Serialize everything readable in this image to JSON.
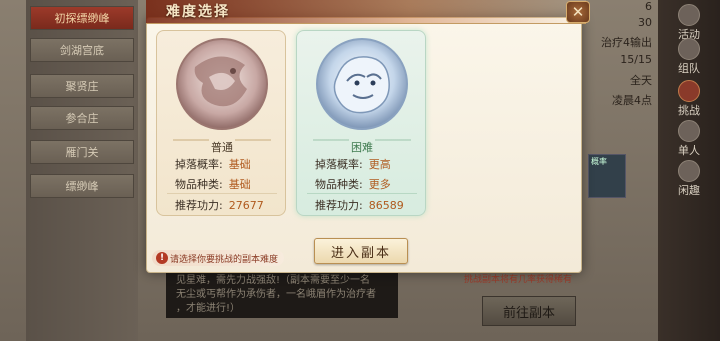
{
  "background": {
    "left_menu": [
      "初探缥缈峰",
      "剑湖宫底",
      "聚贤庄",
      "参合庄",
      "雁门关",
      "缥缈峰"
    ],
    "right_info": [
      "6",
      "30",
      "治疗4输出",
      "15/15",
      "全天",
      "凌晨4点"
    ],
    "thumb_badge": "概率",
    "nav": [
      {
        "label": "活动",
        "icon": "gift-icon"
      },
      {
        "label": "组队",
        "icon": "team-icon"
      },
      {
        "label": "挑战",
        "icon": "challenge-icon",
        "active": true
      },
      {
        "label": "单人",
        "icon": "single-icon"
      },
      {
        "label": "闲趣",
        "icon": "leisure-icon"
      }
    ],
    "desc_lines": [
      "见星难，需先力战强敌!（副本需要至少一名",
      "无尘或丐帮作为承伤者，一名峨眉作为治疗者",
      "，才能进行!）"
    ],
    "note": "挑战副本将有几率获得稀有",
    "goto_button": "前往副本"
  },
  "modal": {
    "title": "难度选择",
    "close_icon": "close-icon",
    "cards": [
      {
        "name": "普通",
        "drop_label": "掉落概率:",
        "drop_value": "基础",
        "type_label": "物品种类:",
        "type_value": "基础",
        "power_label": "推荐功力:",
        "power_value": "27677"
      },
      {
        "name": "困难",
        "drop_label": "掉落概率:",
        "drop_value": "更高",
        "type_label": "物品种类:",
        "type_value": "更多",
        "power_label": "推荐功力:",
        "power_value": "86589"
      }
    ],
    "hint": "请选择你要挑战的副本难度",
    "enter_button": "进入副本"
  }
}
